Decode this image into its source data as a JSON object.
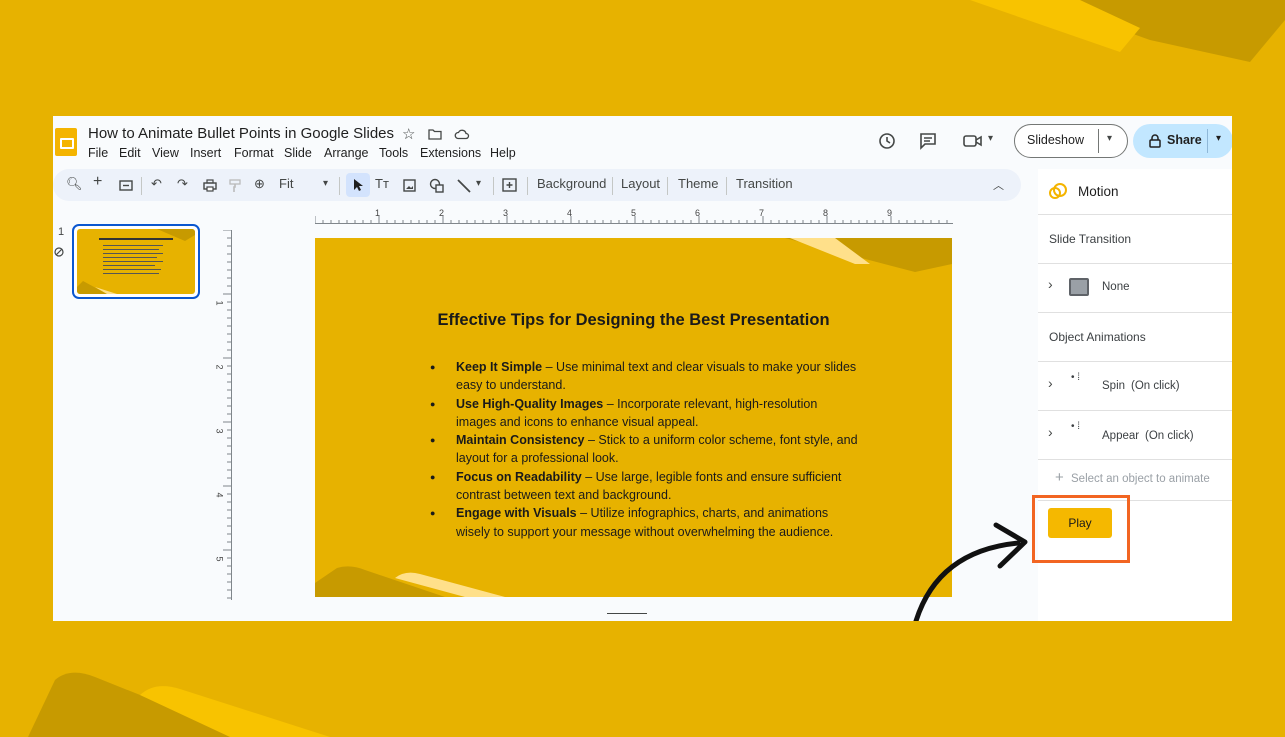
{
  "colors": {
    "background": "#E7B200",
    "accent_highlight": "#F26522",
    "share_button": "#C2E7FF",
    "play_button": "#F5B800"
  },
  "doc": {
    "title": "How to Animate Bullet Points in Google Slides",
    "menu": [
      "File",
      "Edit",
      "View",
      "Insert",
      "Format",
      "Slide",
      "Arrange",
      "Tools",
      "Extensions",
      "Help"
    ]
  },
  "header": {
    "slideshow_label": "Slideshow",
    "share_label": "Share"
  },
  "toolbar": {
    "zoom_value": "Fit",
    "buttons": [
      "Background",
      "Layout",
      "Theme",
      "Transition"
    ]
  },
  "rulers": {
    "horizontal": [
      "1",
      "2",
      "3",
      "4",
      "5",
      "6",
      "7",
      "8",
      "9"
    ],
    "vertical": [
      "1",
      "2",
      "3",
      "4",
      "5"
    ]
  },
  "filmstrip": {
    "slide_number": "1"
  },
  "slide": {
    "title": "Effective Tips for Designing the Best Presentation",
    "bullets": [
      {
        "bold": "Keep It Simple",
        "rest": " – Use minimal text and clear visuals to make your slides easy to understand."
      },
      {
        "bold": "Use High-Quality Images",
        "rest": " – Incorporate relevant, high-resolution images and icons to enhance visual appeal."
      },
      {
        "bold": "Maintain Consistency",
        "rest": " – Stick to a uniform color scheme, font style, and layout for a professional look."
      },
      {
        "bold": "Focus on Readability",
        "rest": " – Use large, legible fonts and ensure sufficient contrast between text and background."
      },
      {
        "bold": "Engage with Visuals",
        "rest": " – Utilize infographics, charts, and animations wisely to support your message without overwhelming the audience."
      }
    ]
  },
  "motion_panel": {
    "title": "Motion",
    "slide_transition_heading": "Slide Transition",
    "transition_value": "None",
    "object_animations_heading": "Object Animations",
    "animations": [
      {
        "name": "Spin",
        "trigger": "(On click)"
      },
      {
        "name": "Appear",
        "trigger": "(On click)"
      }
    ],
    "select_prompt": "Select an object to animate",
    "play_label": "Play"
  }
}
